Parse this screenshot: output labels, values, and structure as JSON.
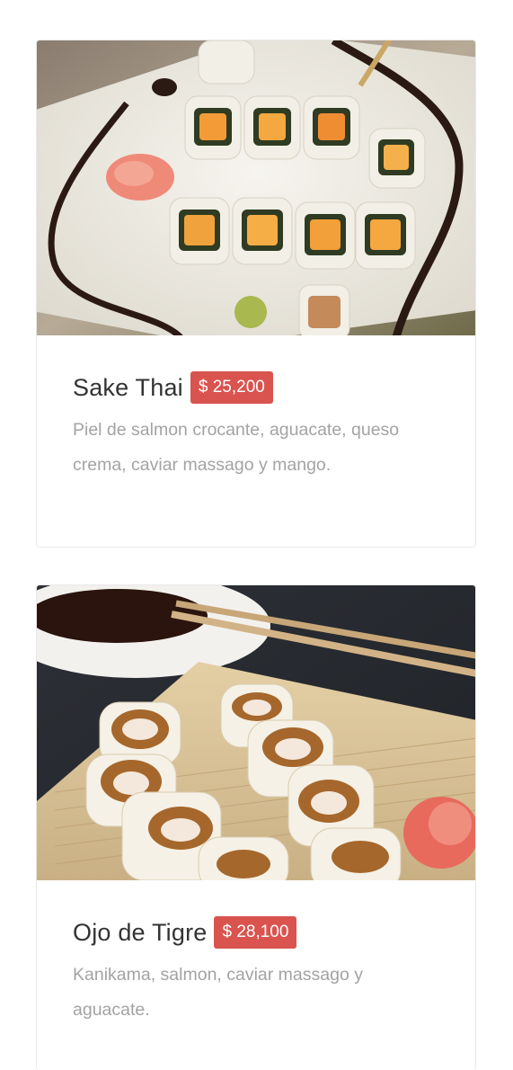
{
  "menu_items": [
    {
      "name": "Sake Thai",
      "price": "$ 25,200",
      "description": "Piel de salmon crocante, aguacate, queso crema, caviar massago y mango.",
      "image_icon": "sushi-plate-photo"
    },
    {
      "name": "Ojo de Tigre",
      "price": "$ 28,100",
      "description": "Kanikama, salmon, caviar massago y aguacate.",
      "image_icon": "sushi-mat-photo"
    }
  ],
  "colors": {
    "price_badge": "#d9534f",
    "name_text": "#333333",
    "description_text": "#a3a3a3",
    "card_border": "#e8e8e8"
  }
}
